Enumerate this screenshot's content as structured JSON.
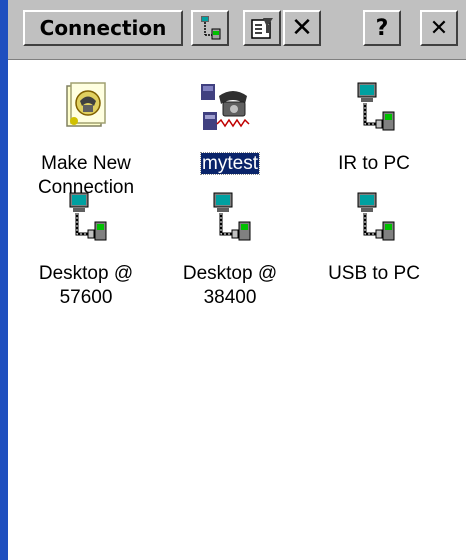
{
  "toolbar": {
    "title": "Connection",
    "buttons": [
      {
        "name": "connect-icon"
      },
      {
        "name": "properties-icon"
      },
      {
        "name": "delete-icon",
        "label": "✕"
      },
      {
        "name": "help-button",
        "label": "?"
      },
      {
        "name": "close-button",
        "label": "✕"
      }
    ]
  },
  "items": [
    {
      "icon": "make-connection-icon",
      "label": "Make New\nConnection",
      "selected": false
    },
    {
      "icon": "modem-connection-icon",
      "label": "mytest",
      "selected": true
    },
    {
      "icon": "direct-connection-icon",
      "label": "IR to PC",
      "selected": false
    },
    {
      "icon": "direct-connection-icon",
      "label": "Desktop @\n57600",
      "selected": false
    },
    {
      "icon": "direct-connection-icon",
      "label": "Desktop @\n38400",
      "selected": false
    },
    {
      "icon": "direct-connection-icon",
      "label": "USB to PC",
      "selected": false
    }
  ],
  "colors": {
    "selection_bg": "#0a246a",
    "toolbar_bg": "#c0c0c0",
    "left_strip": "#1f4fbf"
  }
}
